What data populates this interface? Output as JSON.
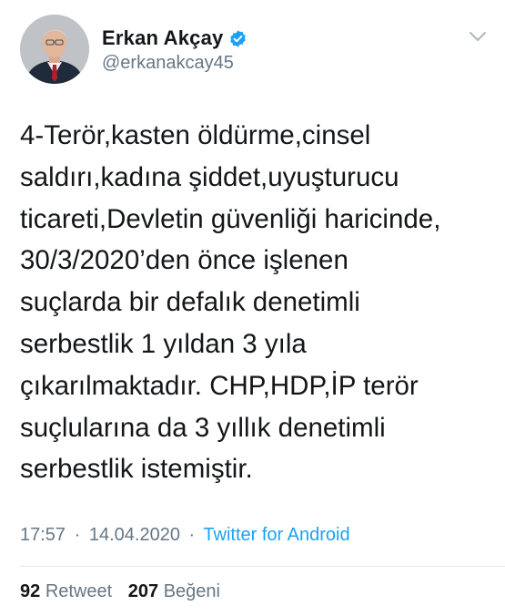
{
  "author": {
    "name": "Erkan Akçay",
    "handle": "@erkanakcay45",
    "verified": true
  },
  "tweet": {
    "text": "4-Terör,kasten öldürme,cinsel\nsaldırı,kadına şiddet,uyuşturucu\nticareti,Devletin güvenliği haricinde,\n30/3/2020’den önce işlenen\nsuçlarda bir defalık denetimli\nserbestlik 1 yıldan 3 yıla\nçıkarılmaktadır. CHP,HDP,İP terör\nsuçlularına da 3 yıllık denetimli\nserbestlik istemiştir."
  },
  "meta": {
    "time": "17:57",
    "separator": "·",
    "date": "14.04.2020",
    "source": "Twitter for Android"
  },
  "stats": {
    "retweets_count": "92",
    "retweets_label": "Retweet",
    "likes_count": "207",
    "likes_label": "Beğeni"
  },
  "icons": {
    "verified": "verified-badge-icon",
    "menu": "chevron-down-icon"
  },
  "colors": {
    "text": "#14171a",
    "secondary": "#657786",
    "link": "#1da1f2",
    "divider": "#e1e8ed"
  }
}
